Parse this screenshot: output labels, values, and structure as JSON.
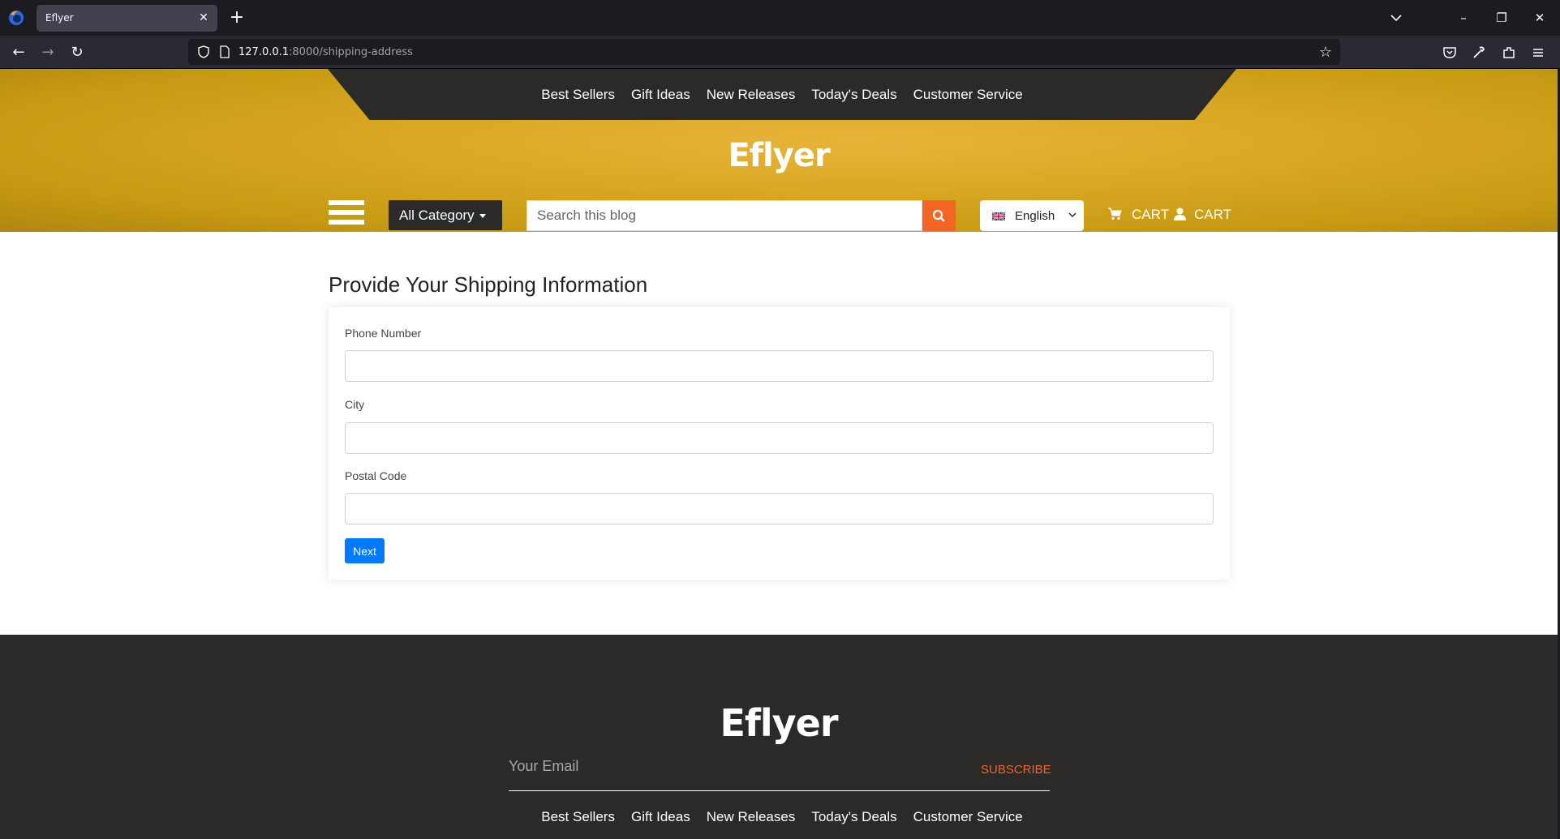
{
  "browser": {
    "tab_title": "Eflyer",
    "url_host": "127.0.0.1",
    "url_rest": ":8000/shipping-address"
  },
  "site": {
    "brand": "Eflyer",
    "nav": [
      "Best Sellers",
      "Gift Ideas",
      "New Releases",
      "Today's Deals",
      "Customer Service"
    ],
    "category_label": "All Category",
    "search_placeholder": "Search this blog",
    "language": "English",
    "cart_label": "CART",
    "account_label": "CART"
  },
  "form": {
    "title": "Provide Your Shipping Information",
    "phone_label": "Phone Number",
    "city_label": "City",
    "postal_label": "Postal Code",
    "phone_value": "",
    "city_value": "",
    "postal_value": "",
    "next_label": "Next"
  },
  "footer": {
    "brand": "Eflyer",
    "email_placeholder": "Your Email",
    "subscribe_label": "SUBSCRIBE",
    "nav": [
      "Best Sellers",
      "Gift Ideas",
      "New Releases",
      "Today's Deals",
      "Customer Service"
    ]
  },
  "colors": {
    "accent": "#f26522",
    "dark": "#2b2a29",
    "primary_button": "#007bff",
    "hero_gold": "#d9a722"
  }
}
